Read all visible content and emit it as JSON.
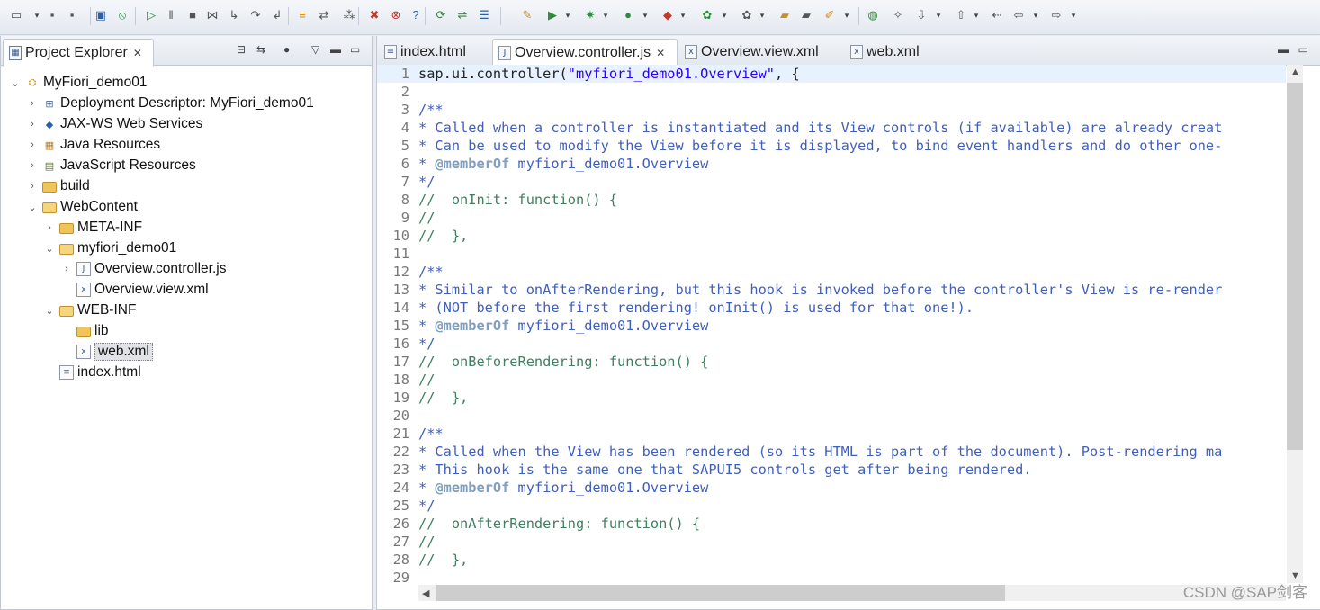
{
  "explorer": {
    "title": "Project Explorer",
    "tree": [
      {
        "label": "MyFiori_demo01",
        "icon": "project-icon",
        "twisty": "expanded",
        "level": 0
      },
      {
        "label": "Deployment Descriptor: MyFiori_demo01",
        "icon": "deployment-descriptor-icon",
        "twisty": "collapsed",
        "level": 1
      },
      {
        "label": "JAX-WS Web Services",
        "icon": "web-services-icon",
        "twisty": "collapsed",
        "level": 1
      },
      {
        "label": "Java Resources",
        "icon": "java-resources-icon",
        "twisty": "collapsed",
        "level": 1
      },
      {
        "label": "JavaScript Resources",
        "icon": "javascript-resources-icon",
        "twisty": "collapsed",
        "level": 1
      },
      {
        "label": "build",
        "icon": "folder-icon",
        "twisty": "collapsed",
        "level": 1
      },
      {
        "label": "WebContent",
        "icon": "folder-open-icon",
        "twisty": "expanded",
        "level": 1
      },
      {
        "label": "META-INF",
        "icon": "folder-icon",
        "twisty": "collapsed",
        "level": 2
      },
      {
        "label": "myfiori_demo01",
        "icon": "folder-open-icon",
        "twisty": "expanded",
        "level": 2
      },
      {
        "label": "Overview.controller.js",
        "icon": "js-file-icon",
        "twisty": "collapsed",
        "level": 3
      },
      {
        "label": "Overview.view.xml",
        "icon": "xml-file-icon",
        "twisty": "none",
        "level": 3
      },
      {
        "label": "WEB-INF",
        "icon": "folder-open-icon",
        "twisty": "expanded",
        "level": 2
      },
      {
        "label": "lib",
        "icon": "folder-icon",
        "twisty": "none",
        "level": 3
      },
      {
        "label": "web.xml",
        "icon": "xml-file-icon",
        "twisty": "none",
        "level": 3,
        "selected": true
      },
      {
        "label": "index.html",
        "icon": "html-file-icon",
        "twisty": "none",
        "level": 2
      }
    ]
  },
  "editor": {
    "tabs": [
      {
        "label": "index.html",
        "icon": "html-file-icon",
        "active": false
      },
      {
        "label": "Overview.controller.js",
        "icon": "js-file-icon",
        "active": true
      },
      {
        "label": "Overview.view.xml",
        "icon": "xml-file-icon",
        "active": false
      },
      {
        "label": "web.xml",
        "icon": "xml-file-icon",
        "active": false
      }
    ],
    "lines": [
      [
        [
          "code",
          "sap.ui.controller("
        ],
        [
          "str",
          "\"myfiori_demo01.Overview\""
        ],
        [
          "code",
          ", {"
        ]
      ],
      [],
      [
        [
          "doc",
          "/**"
        ]
      ],
      [
        [
          "doc",
          "* Called when a controller is instantiated and its View controls (if available) are already creat"
        ]
      ],
      [
        [
          "doc",
          "* Can be used to modify the View before it is displayed, to bind event handlers and do other one-"
        ]
      ],
      [
        [
          "doc",
          "* "
        ],
        [
          "docb",
          "@memberOf"
        ],
        [
          "doc",
          " myfiori_demo01.Overview"
        ]
      ],
      [
        [
          "doc",
          "*/"
        ]
      ],
      [
        [
          "cmt",
          "//  onInit: function() {"
        ]
      ],
      [
        [
          "cmt",
          "//"
        ]
      ],
      [
        [
          "cmt",
          "//  },"
        ]
      ],
      [],
      [
        [
          "doc",
          "/**"
        ]
      ],
      [
        [
          "doc",
          "* Similar to onAfterRendering, but this hook is invoked before the controller's View is re-render"
        ]
      ],
      [
        [
          "doc",
          "* (NOT before the first rendering! onInit() is used for that one!)."
        ]
      ],
      [
        [
          "doc",
          "* "
        ],
        [
          "docb",
          "@memberOf"
        ],
        [
          "doc",
          " myfiori_demo01.Overview"
        ]
      ],
      [
        [
          "doc",
          "*/"
        ]
      ],
      [
        [
          "cmt",
          "//  onBeforeRendering: function() {"
        ]
      ],
      [
        [
          "cmt",
          "//"
        ]
      ],
      [
        [
          "cmt",
          "//  },"
        ]
      ],
      [],
      [
        [
          "doc",
          "/**"
        ]
      ],
      [
        [
          "doc",
          "* Called when the View has been rendered (so its HTML is part of the document). Post-rendering ma"
        ]
      ],
      [
        [
          "doc",
          "* This hook is the same one that SAPUI5 controls get after being rendered."
        ]
      ],
      [
        [
          "doc",
          "* "
        ],
        [
          "docb",
          "@memberOf"
        ],
        [
          "doc",
          " myfiori_demo01.Overview"
        ]
      ],
      [
        [
          "doc",
          "*/"
        ]
      ],
      [
        [
          "cmt",
          "//  onAfterRendering: function() {"
        ]
      ],
      [
        [
          "cmt",
          "//"
        ]
      ],
      [
        [
          "cmt",
          "//  },"
        ]
      ],
      []
    ],
    "current_line": 1
  },
  "watermark": "CSDN @SAP剑客",
  "colors": {
    "doc_comment": "#3f5fbf",
    "doc_tag": "#7f9fbf",
    "line_comment": "#3f7f5f",
    "string": "#2a00ff",
    "current_line": "#e8f2fe"
  }
}
